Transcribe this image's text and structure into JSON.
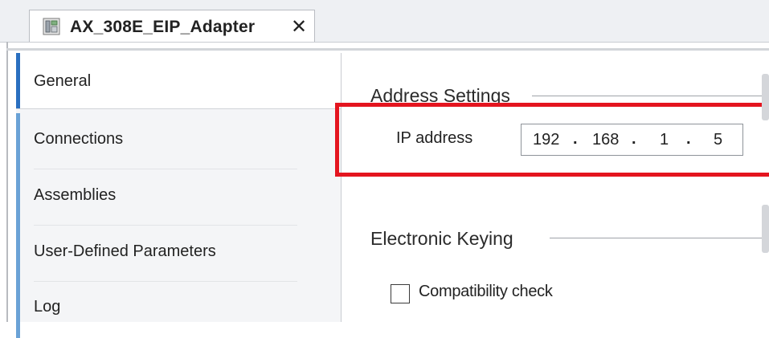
{
  "tab": {
    "title": "AX_308E_EIP_Adapter",
    "close_glyph": "✕",
    "icon": "device-icon"
  },
  "sidebar": {
    "items": [
      {
        "label": "General",
        "active": true
      },
      {
        "label": "Connections",
        "active": false
      },
      {
        "label": "Assemblies",
        "active": false
      },
      {
        "label": "User-Defined Parameters",
        "active": false
      },
      {
        "label": "Log",
        "active": false
      }
    ]
  },
  "address_settings": {
    "section_title": "Address Settings",
    "ip_label": "IP address",
    "ip_octets": [
      "192",
      "168",
      "1",
      "5"
    ],
    "ip_separator": "."
  },
  "electronic_keying": {
    "section_title": "Electronic Keying",
    "compatibility_check": {
      "label": "Compatibility check",
      "checked": false
    }
  },
  "colors": {
    "highlight": "#e4151f",
    "nav_accent": "#6aa2d6"
  }
}
